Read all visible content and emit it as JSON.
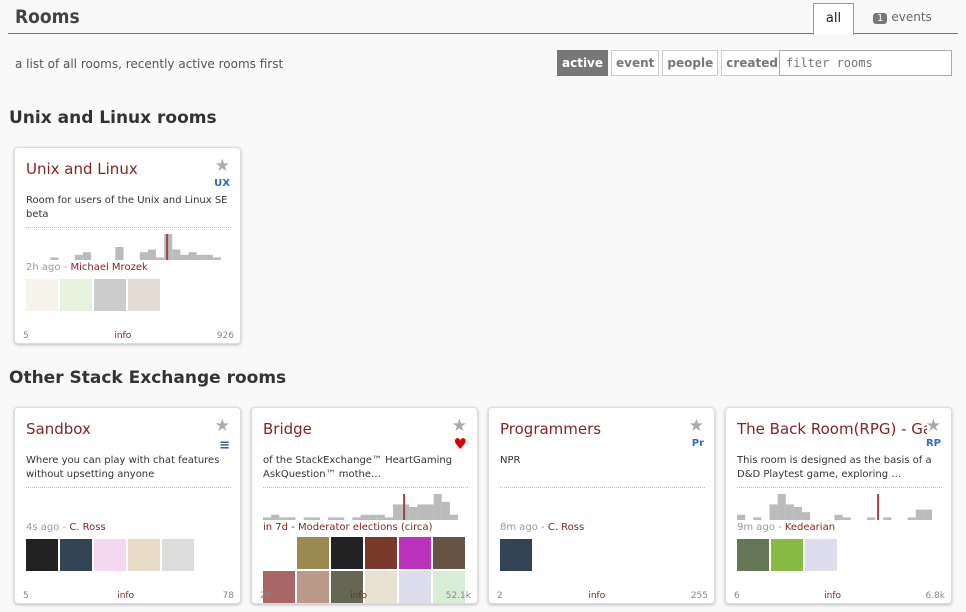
{
  "header": {
    "title": "Rooms",
    "tab_all": "all",
    "tab_events_count": "1",
    "tab_events": "events"
  },
  "subtitle": "a list of all rooms, recently active rooms first",
  "sort": [
    "active",
    "event",
    "people",
    "created"
  ],
  "filter_placeholder": "filter rooms",
  "sections": [
    "Unix and Linux rooms",
    "Other Stack Exchange rooms"
  ],
  "rooms": [
    {
      "name": "Unix and Linux",
      "icon": "UX",
      "desc": "Room for users of the Unix and Linux SE beta",
      "when": "2h ago - ",
      "who": "Michael Mrozek",
      "users": "5",
      "info": "info",
      "messages": "926",
      "activity": [
        0,
        0,
        0,
        1,
        0,
        0,
        2,
        3,
        0,
        0,
        0,
        5,
        0,
        0,
        3,
        4,
        1,
        10,
        4,
        2,
        3,
        2,
        2,
        1
      ],
      "marker": 17,
      "avatars": [
        "#eee8d8",
        "#cfe8c0",
        "#999",
        "#c9b9a9"
      ],
      "faded": true
    },
    {
      "name": "Sandbox",
      "icon": "stack-icon",
      "desc": "Where you can play with chat features without upsetting anyone",
      "when": "4s ago - ",
      "who": "C. Ross",
      "users": "5",
      "info": "info",
      "messages": "78",
      "activity": [],
      "marker": -1,
      "avatars": [
        "#222",
        "#345",
        "#f3d8f0",
        "#e8dcc8",
        "#ddd"
      ]
    },
    {
      "name": "Bridge",
      "icon": "heart-icon",
      "desc": "of the StackExchange™ HeartGaming AskQuestion™ mothe…",
      "when": "",
      "who": "in 7d - Moderator elections (circa)",
      "users": "20",
      "info": "info",
      "messages": "52.1k",
      "activity": [
        1,
        2,
        1,
        1,
        0,
        1,
        1,
        0,
        1,
        1,
        0,
        1,
        2,
        2,
        2,
        1,
        6,
        6,
        5,
        6,
        6,
        10,
        7,
        2
      ],
      "marker": 17,
      "avatars": [
        "#fff",
        "#9a8a50",
        "#222",
        "#7a3a2a",
        "#b3b",
        "#654",
        "#a66",
        "#b98",
        "#665",
        "#e8e0d0",
        "#dde",
        "#d8ecd8"
      ]
    },
    {
      "name": "Programmers",
      "icon": "Pr",
      "desc": "NPR",
      "when": "8m ago - ",
      "who": "C. Ross",
      "users": "2",
      "info": "info",
      "messages": "255",
      "activity": [],
      "marker": -1,
      "avatars": [
        "#345"
      ]
    },
    {
      "name": "The Back Room(RPG) - Gaming",
      "icon": "RP",
      "desc": "This room is designed as the basis of a D&D Playtest game, exploring …",
      "when": "9m ago - ",
      "who": "Kedearian",
      "users": "6",
      "info": "info",
      "messages": "6.8k",
      "activity": [
        2,
        0,
        1,
        0,
        6,
        10,
        6,
        5,
        3,
        0,
        0,
        0,
        2,
        1,
        0,
        0,
        1,
        0,
        1,
        0,
        0,
        1,
        4,
        4
      ],
      "marker": 17,
      "avatars": [
        "#675",
        "#8b4",
        "#dde"
      ]
    }
  ]
}
